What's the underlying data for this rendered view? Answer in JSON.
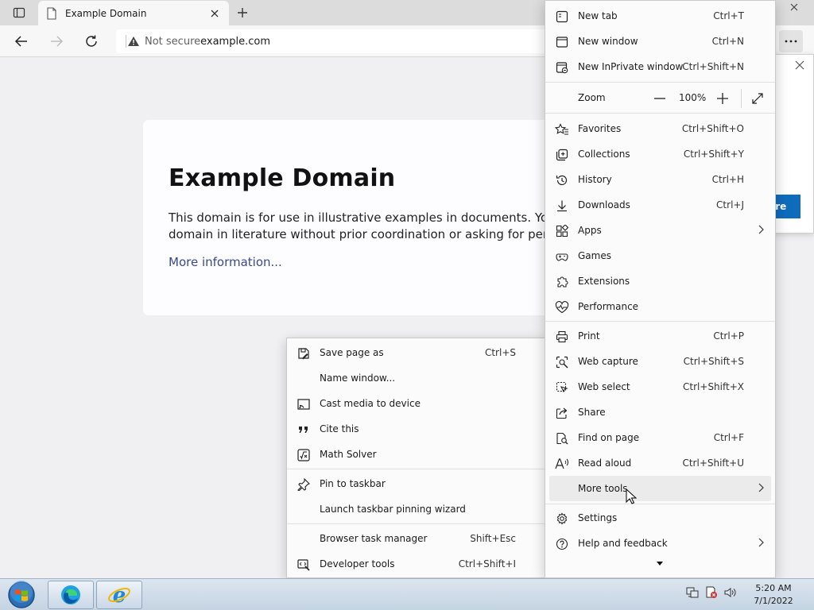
{
  "tab": {
    "title": "Example Domain"
  },
  "address": {
    "security": "Not secure",
    "url": "example.com"
  },
  "page": {
    "heading": "Example Domain",
    "paragraph_line1": "This domain is for use in illustrative examples in documents. You ma",
    "paragraph_line2": "domain in literature without prior coordination or asking for permis",
    "link": "More information..."
  },
  "popup": {
    "button_label": "ore"
  },
  "menu": {
    "new_tab": {
      "label": "New tab",
      "shortcut": "Ctrl+T"
    },
    "new_window": {
      "label": "New window",
      "shortcut": "Ctrl+N"
    },
    "new_inprivate": {
      "label": "New InPrivate window",
      "shortcut": "Ctrl+Shift+N"
    },
    "zoom": {
      "label": "Zoom",
      "value": "100%"
    },
    "favorites": {
      "label": "Favorites",
      "shortcut": "Ctrl+Shift+O"
    },
    "collections": {
      "label": "Collections",
      "shortcut": "Ctrl+Shift+Y"
    },
    "history": {
      "label": "History",
      "shortcut": "Ctrl+H"
    },
    "downloads": {
      "label": "Downloads",
      "shortcut": "Ctrl+J"
    },
    "apps": {
      "label": "Apps"
    },
    "games": {
      "label": "Games"
    },
    "extensions": {
      "label": "Extensions"
    },
    "performance": {
      "label": "Performance"
    },
    "print": {
      "label": "Print",
      "shortcut": "Ctrl+P"
    },
    "web_capture": {
      "label": "Web capture",
      "shortcut": "Ctrl+Shift+S"
    },
    "web_select": {
      "label": "Web select",
      "shortcut": "Ctrl+Shift+X"
    },
    "share": {
      "label": "Share"
    },
    "find_on_page": {
      "label": "Find on page",
      "shortcut": "Ctrl+F"
    },
    "read_aloud": {
      "label": "Read aloud",
      "shortcut": "Ctrl+Shift+U"
    },
    "more_tools": {
      "label": "More tools"
    },
    "settings": {
      "label": "Settings"
    },
    "help": {
      "label": "Help and feedback"
    }
  },
  "submenu": {
    "save_page": {
      "label": "Save page as",
      "shortcut": "Ctrl+S"
    },
    "name_window": {
      "label": "Name window..."
    },
    "cast_media": {
      "label": "Cast media to device"
    },
    "cite_this": {
      "label": "Cite this"
    },
    "math_solver": {
      "label": "Math Solver"
    },
    "pin_taskbar": {
      "label": "Pin to taskbar"
    },
    "pin_wizard": {
      "label": "Launch taskbar pinning wizard"
    },
    "task_manager": {
      "label": "Browser task manager",
      "shortcut": "Shift+Esc"
    },
    "dev_tools": {
      "label": "Developer tools",
      "shortcut": "Ctrl+Shift+I"
    }
  },
  "taskbar": {
    "time": "5:20 AM",
    "date": "7/1/2022"
  },
  "colors": {
    "accent": "#0f6cbd",
    "link": "#38488f",
    "menu_bg": "#fbfbfb"
  }
}
